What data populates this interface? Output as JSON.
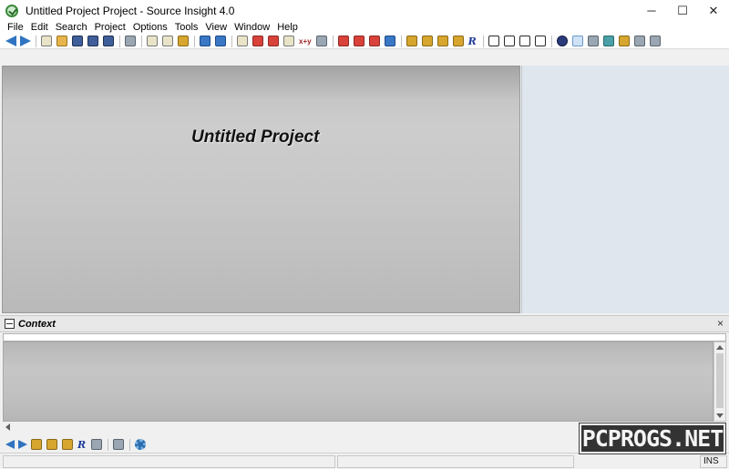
{
  "window": {
    "title": "Untitled Project Project - Source Insight 4.0",
    "controls": {
      "minimize": "─",
      "maximize": "☐",
      "close": "✕"
    }
  },
  "menu": [
    "File",
    "Edit",
    "Search",
    "Project",
    "Options",
    "Tools",
    "View",
    "Window",
    "Help"
  ],
  "toolbar": {
    "xy_label": "x+y",
    "r_label": "R"
  },
  "main": {
    "project_title": "Untitled Project"
  },
  "context": {
    "title": "Context",
    "close": "×"
  },
  "bottom_toolbar": {
    "r_label": "R"
  },
  "status": {
    "mode": "INS"
  },
  "watermark": "PCPROGS.NET",
  "colors": {
    "accent_blue": "#2f74c0",
    "side_pane": "#e0e6ee",
    "main_pane_gray": "#c6c6c6"
  }
}
